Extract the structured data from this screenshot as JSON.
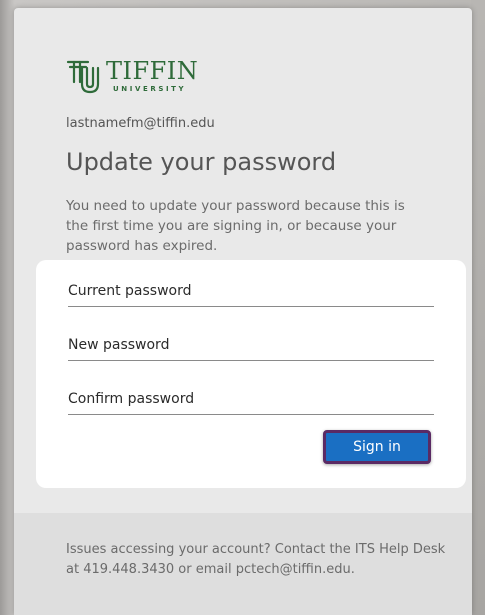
{
  "brand": {
    "name": "TIFFIN",
    "subtitle": "UNIVERSITY",
    "color": "#2f6b3a"
  },
  "account": {
    "email": "lastnamefm@tiffin.edu"
  },
  "page": {
    "title": "Update your password",
    "description": "You need to update your password because this is the first time you are signing in, or because your password has expired."
  },
  "form": {
    "current_password_placeholder": "Current password",
    "new_password_placeholder": "New password",
    "confirm_password_placeholder": "Confirm password",
    "submit_label": "Sign in",
    "submit_color": "#1a6fc3"
  },
  "footer": {
    "help_text": "Issues accessing your account? Contact the ITS Help Desk at 419.448.3430 or email pctech@tiffin.edu."
  }
}
